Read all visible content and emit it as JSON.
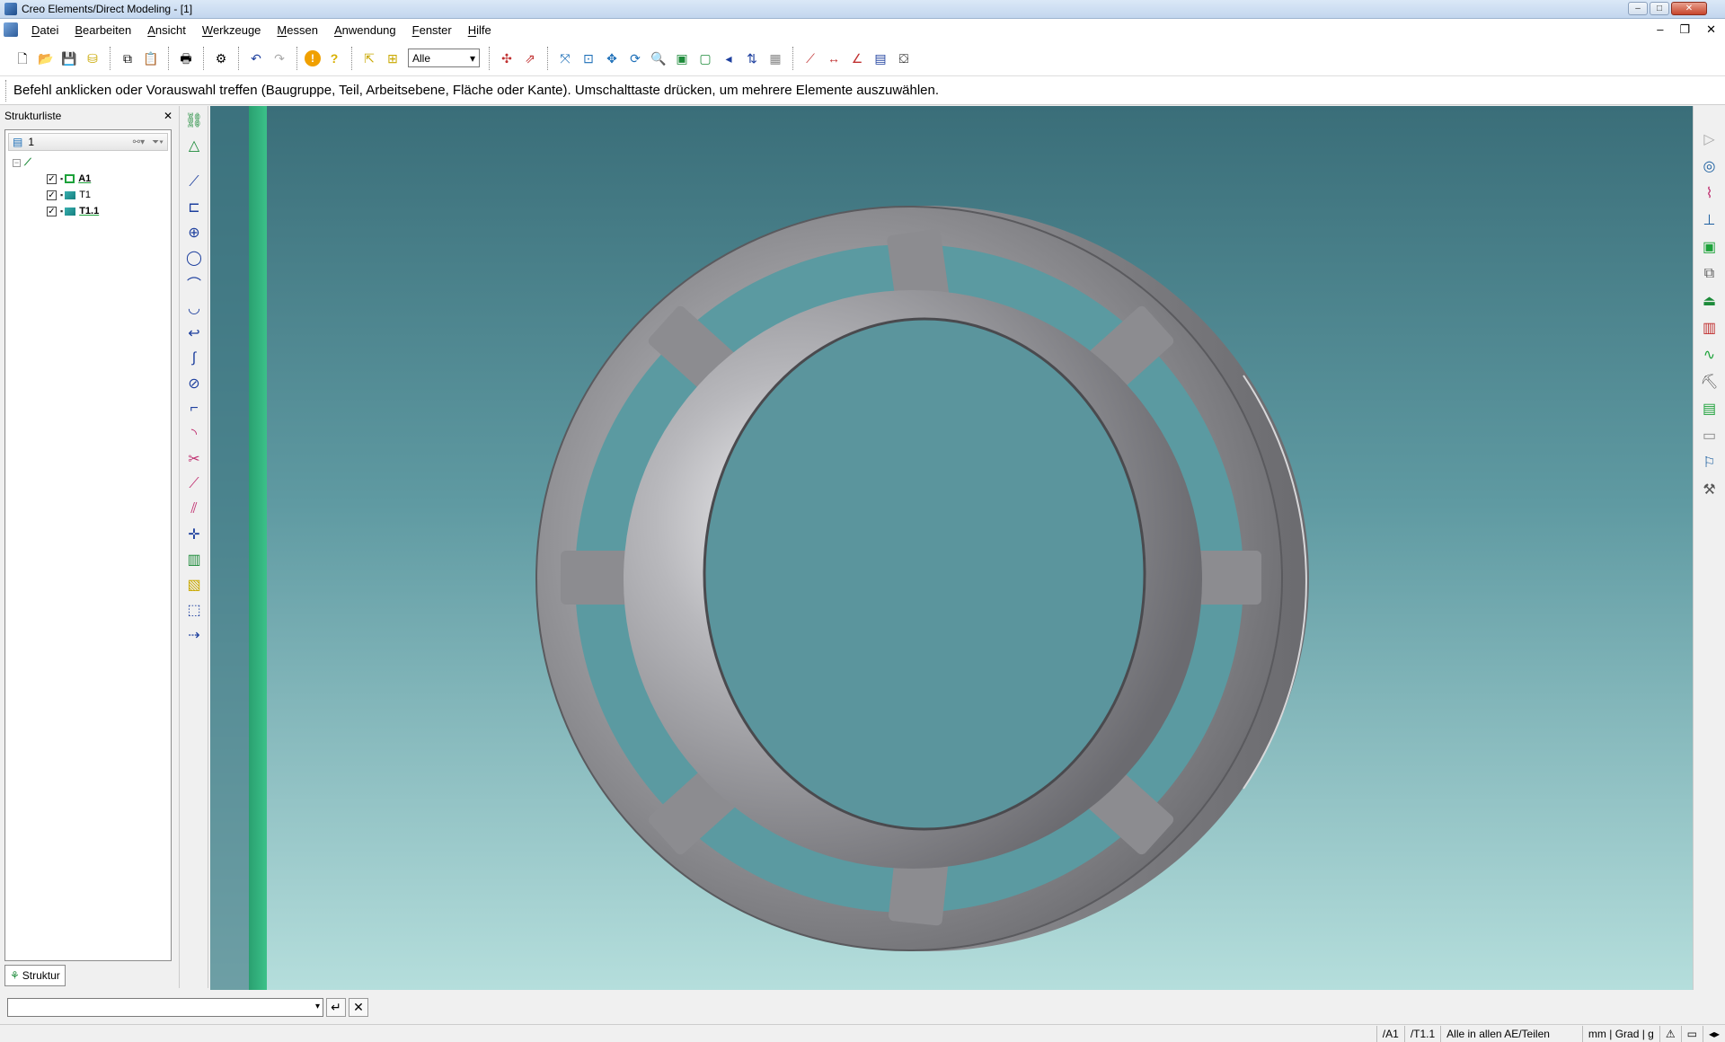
{
  "window": {
    "title": "Creo Elements/Direct Modeling - [1]"
  },
  "menu": {
    "items": [
      "Datei",
      "Bearbeiten",
      "Ansicht",
      "Werkzeuge",
      "Messen",
      "Anwendung",
      "Fenster",
      "Hilfe"
    ]
  },
  "toolbar": {
    "filter_value": "Alle"
  },
  "prompt": {
    "text": "Befehl anklicken oder Vorauswahl treffen (Baugruppe, Teil, Arbeitsebene, Fläche oder Kante). Umschalttaste drücken, um mehrere Elemente auszuwählen."
  },
  "structure": {
    "title": "Strukturliste",
    "head_label": "1",
    "items": [
      {
        "label": "A1"
      },
      {
        "label": "T1"
      },
      {
        "label": "T1.1"
      }
    ],
    "tab_label": "Struktur"
  },
  "status": {
    "cells": [
      "/A1",
      "/T1.1",
      "Alle in allen AE/Teilen",
      "mm | Grad | g"
    ]
  },
  "colors": {
    "viewport_top": "#3a6e79",
    "viewport_bottom": "#b5dedc",
    "part_gray": "#8b8b8f",
    "workplane_green": "#2fb07a"
  },
  "icons": {
    "toolbar": [
      "new-icon",
      "open-icon",
      "save-icon",
      "cylinder-icon",
      "copy-icon",
      "paste-icon",
      "print-icon",
      "filter-icon",
      "undo-icon",
      "redo-icon",
      "info-icon",
      "help-icon",
      "select-icon",
      "select-options-icon",
      "select-dynamic-icon",
      "select-pick-icon",
      "fit-icon",
      "zoom-box-icon",
      "pan-icon",
      "rotate-icon",
      "zoom-icon",
      "shaded-icon",
      "wireframe-icon",
      "previous-view-icon",
      "align-icon",
      "section-icon",
      "measure-line-icon",
      "measure-distance-icon",
      "measure-angle-icon",
      "calculator-icon",
      "render-icon"
    ],
    "left_vertical": [
      "structure-icon",
      "part-icon",
      "line-icon",
      "rectangle-icon",
      "circle-icon",
      "ellipse-icon",
      "arc-icon",
      "tangent-arc-icon",
      "hook-icon",
      "spline-icon",
      "offset-icon",
      "fillet-icon",
      "chamfer-icon",
      "trim-icon",
      "construction-line-icon",
      "parallel-line-icon",
      "cross-icon",
      "extrude-icon",
      "mill-icon",
      "box-select-icon",
      "dimension-icon"
    ],
    "right_vertical": [
      "play-icon",
      "lasso-icon",
      "graph-icon",
      "axis-icon",
      "green-square-icon",
      "copy-face-icon",
      "stand-icon",
      "ruler-icon",
      "wave-icon",
      "tool-icon",
      "sheet-icon",
      "page-icon",
      "flag-icon",
      "wrench-icon"
    ]
  }
}
